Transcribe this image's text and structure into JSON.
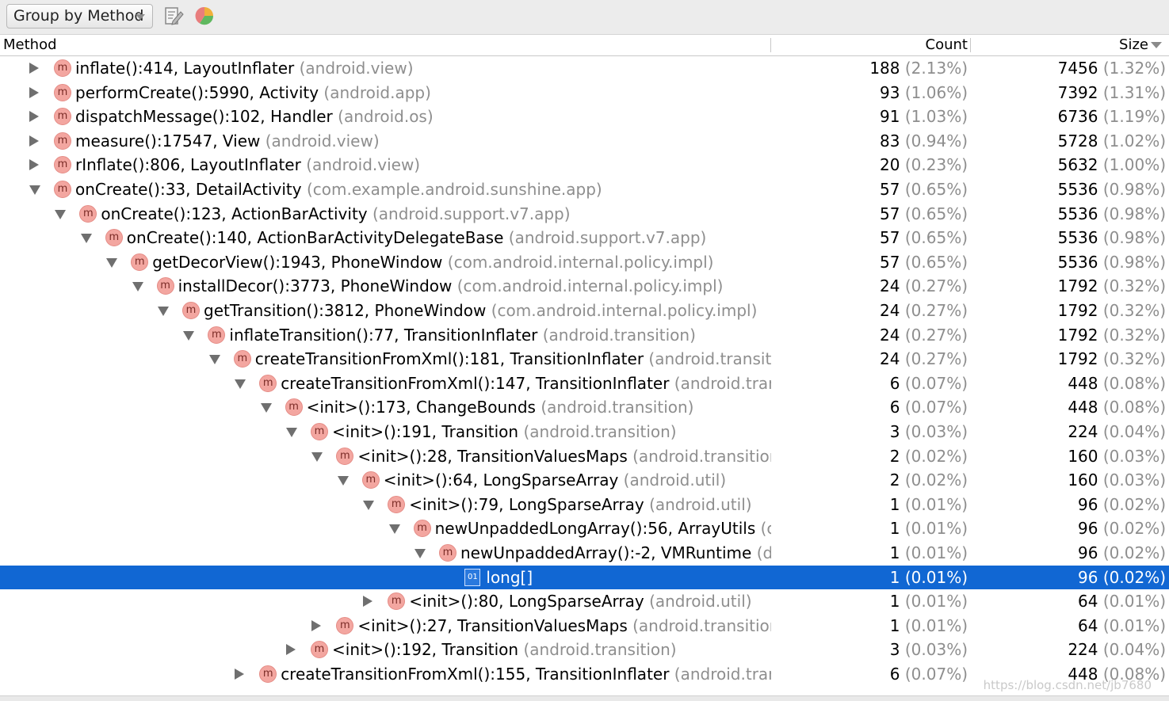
{
  "toolbar": {
    "group_label": "Group by Method",
    "edit_icon": "edit-filter-icon",
    "chart_icon": "pie-chart-icon"
  },
  "header": {
    "method": "Method",
    "count": "Count",
    "size": "Size"
  },
  "rows": [
    {
      "state": "collapsed",
      "depth": 0,
      "icon": "method",
      "name": "inflate():414, LayoutInflater",
      "pkg": "(android.view)",
      "count": "188",
      "count_pct": "(2.13%)",
      "size": "7456",
      "size_pct": "(1.32%)"
    },
    {
      "state": "collapsed",
      "depth": 0,
      "icon": "method",
      "name": "performCreate():5990, Activity",
      "pkg": "(android.app)",
      "count": "93",
      "count_pct": "(1.06%)",
      "size": "7392",
      "size_pct": "(1.31%)"
    },
    {
      "state": "collapsed",
      "depth": 0,
      "icon": "method",
      "name": "dispatchMessage():102, Handler",
      "pkg": "(android.os)",
      "count": "91",
      "count_pct": "(1.03%)",
      "size": "6736",
      "size_pct": "(1.19%)"
    },
    {
      "state": "collapsed",
      "depth": 0,
      "icon": "method",
      "name": "measure():17547, View",
      "pkg": "(android.view)",
      "count": "83",
      "count_pct": "(0.94%)",
      "size": "5728",
      "size_pct": "(1.02%)"
    },
    {
      "state": "collapsed",
      "depth": 0,
      "icon": "method",
      "name": "rInflate():806, LayoutInflater",
      "pkg": "(android.view)",
      "count": "20",
      "count_pct": "(0.23%)",
      "size": "5632",
      "size_pct": "(1.00%)"
    },
    {
      "state": "expanded",
      "depth": 0,
      "icon": "method",
      "name": "onCreate():33, DetailActivity",
      "pkg": "(com.example.android.sunshine.app)",
      "count": "57",
      "count_pct": "(0.65%)",
      "size": "5536",
      "size_pct": "(0.98%)"
    },
    {
      "state": "expanded",
      "depth": 1,
      "icon": "method",
      "name": "onCreate():123, ActionBarActivity",
      "pkg": "(android.support.v7.app)",
      "count": "57",
      "count_pct": "(0.65%)",
      "size": "5536",
      "size_pct": "(0.98%)"
    },
    {
      "state": "expanded",
      "depth": 2,
      "icon": "method",
      "name": "onCreate():140, ActionBarActivityDelegateBase",
      "pkg": "(android.support.v7.app)",
      "count": "57",
      "count_pct": "(0.65%)",
      "size": "5536",
      "size_pct": "(0.98%)"
    },
    {
      "state": "expanded",
      "depth": 3,
      "icon": "method",
      "name": "getDecorView():1943, PhoneWindow",
      "pkg": "(com.android.internal.policy.impl)",
      "count": "57",
      "count_pct": "(0.65%)",
      "size": "5536",
      "size_pct": "(0.98%)"
    },
    {
      "state": "expanded",
      "depth": 4,
      "icon": "method",
      "name": "installDecor():3773, PhoneWindow",
      "pkg": "(com.android.internal.policy.impl)",
      "count": "24",
      "count_pct": "(0.27%)",
      "size": "1792",
      "size_pct": "(0.32%)"
    },
    {
      "state": "expanded",
      "depth": 5,
      "icon": "method",
      "name": "getTransition():3812, PhoneWindow",
      "pkg": "(com.android.internal.policy.impl)",
      "count": "24",
      "count_pct": "(0.27%)",
      "size": "1792",
      "size_pct": "(0.32%)"
    },
    {
      "state": "expanded",
      "depth": 6,
      "icon": "method",
      "name": "inflateTransition():77, TransitionInflater",
      "pkg": "(android.transition)",
      "count": "24",
      "count_pct": "(0.27%)",
      "size": "1792",
      "size_pct": "(0.32%)"
    },
    {
      "state": "expanded",
      "depth": 7,
      "icon": "method",
      "name": "createTransitionFromXml():181, TransitionInflater",
      "pkg": "(android.transition)",
      "count": "24",
      "count_pct": "(0.27%)",
      "size": "1792",
      "size_pct": "(0.32%)"
    },
    {
      "state": "expanded",
      "depth": 8,
      "icon": "method",
      "name": "createTransitionFromXml():147, TransitionInflater",
      "pkg": "(android.transitic",
      "count": "6",
      "count_pct": "(0.07%)",
      "size": "448",
      "size_pct": "(0.08%)"
    },
    {
      "state": "expanded",
      "depth": 9,
      "icon": "method",
      "name": "<init>():173, ChangeBounds",
      "pkg": "(android.transition)",
      "count": "6",
      "count_pct": "(0.07%)",
      "size": "448",
      "size_pct": "(0.08%)"
    },
    {
      "state": "expanded",
      "depth": 10,
      "icon": "method",
      "name": "<init>():191, Transition",
      "pkg": "(android.transition)",
      "count": "3",
      "count_pct": "(0.03%)",
      "size": "224",
      "size_pct": "(0.04%)"
    },
    {
      "state": "expanded",
      "depth": 11,
      "icon": "method",
      "name": "<init>():28, TransitionValuesMaps",
      "pkg": "(android.transition)",
      "count": "2",
      "count_pct": "(0.02%)",
      "size": "160",
      "size_pct": "(0.03%)"
    },
    {
      "state": "expanded",
      "depth": 12,
      "icon": "method",
      "name": "<init>():64, LongSparseArray",
      "pkg": "(android.util)",
      "count": "2",
      "count_pct": "(0.02%)",
      "size": "160",
      "size_pct": "(0.03%)"
    },
    {
      "state": "expanded",
      "depth": 13,
      "icon": "method",
      "name": "<init>():79, LongSparseArray",
      "pkg": "(android.util)",
      "count": "1",
      "count_pct": "(0.01%)",
      "size": "96",
      "size_pct": "(0.02%)"
    },
    {
      "state": "expanded",
      "depth": 14,
      "icon": "method",
      "name": "newUnpaddedLongArray():56, ArrayUtils",
      "pkg": "(com",
      "count": "1",
      "count_pct": "(0.01%)",
      "size": "96",
      "size_pct": "(0.02%)"
    },
    {
      "state": "expanded",
      "depth": 15,
      "icon": "method",
      "name": "newUnpaddedArray():-2, VMRuntime",
      "pkg": "(dalv",
      "count": "1",
      "count_pct": "(0.01%)",
      "size": "96",
      "size_pct": "(0.02%)"
    },
    {
      "state": "leaf",
      "depth": 16,
      "icon": "array",
      "name": "long[]",
      "pkg": "",
      "count": "1",
      "count_pct": "(0.01%)",
      "size": "96",
      "size_pct": "(0.02%)",
      "selected": true
    },
    {
      "state": "collapsed",
      "depth": 13,
      "icon": "method",
      "name": "<init>():80, LongSparseArray",
      "pkg": "(android.util)",
      "count": "1",
      "count_pct": "(0.01%)",
      "size": "64",
      "size_pct": "(0.01%)"
    },
    {
      "state": "collapsed",
      "depth": 11,
      "icon": "method",
      "name": "<init>():27, TransitionValuesMaps",
      "pkg": "(android.transition)",
      "count": "1",
      "count_pct": "(0.01%)",
      "size": "64",
      "size_pct": "(0.01%)"
    },
    {
      "state": "collapsed",
      "depth": 10,
      "icon": "method",
      "name": "<init>():192, Transition",
      "pkg": "(android.transition)",
      "count": "3",
      "count_pct": "(0.03%)",
      "size": "224",
      "size_pct": "(0.04%)"
    },
    {
      "state": "collapsed",
      "depth": 8,
      "icon": "method",
      "name": "createTransitionFromXml():155, TransitionInflater",
      "pkg": "(android.transitic",
      "count": "6",
      "count_pct": "(0.07%)",
      "size": "448",
      "size_pct": "(0.08%)"
    }
  ],
  "watermark": "https://blog.csdn.net/jb7680",
  "colors": {
    "selection": "#1167d3",
    "method_icon": "#f3a6a0",
    "package_text": "#8e8e8e"
  }
}
